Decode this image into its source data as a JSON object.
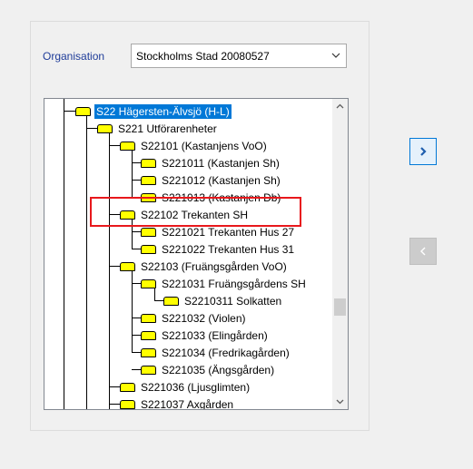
{
  "organisation": {
    "label": "Organisation",
    "selected": "Stockholms Stad 20080527"
  },
  "tree": {
    "items": [
      {
        "text": "S22  Hägersten-Älvsjö (H-L)",
        "selected": true
      },
      {
        "text": "S221  Utförarenheter"
      },
      {
        "text": "S22101  (Kastanjens VoO)"
      },
      {
        "text": "S221011  (Kastanjen Sh)"
      },
      {
        "text": "S221012  (Kastanjen Sh)"
      },
      {
        "text": "S221013  (Kastanjen Db)"
      },
      {
        "text": "S22102  Trekanten SH"
      },
      {
        "text": "S221021  Trekanten Hus 27"
      },
      {
        "text": "S221022  Trekanten Hus 31"
      },
      {
        "text": "S22103  (Fruängsgården VoO)"
      },
      {
        "text": "S221031  Fruängsgårdens SH"
      },
      {
        "text": "S2210311  Solkatten"
      },
      {
        "text": "S221032  (Violen)"
      },
      {
        "text": "S221033  (Elingården)"
      },
      {
        "text": "S221034  (Fredrikagården)"
      },
      {
        "text": "S221035  (Ängsgården)"
      },
      {
        "text": "S221036  (Ljusglimten)"
      },
      {
        "text": "S221037  Axgården"
      }
    ]
  },
  "icons": {
    "add": "chevron-right-icon",
    "remove": "chevron-left-icon",
    "combo": "chevron-down-icon"
  },
  "colors": {
    "selection": "#0078d7",
    "folder": "#ffff00",
    "highlight": "#e8181c",
    "label": "#1f3c99"
  }
}
